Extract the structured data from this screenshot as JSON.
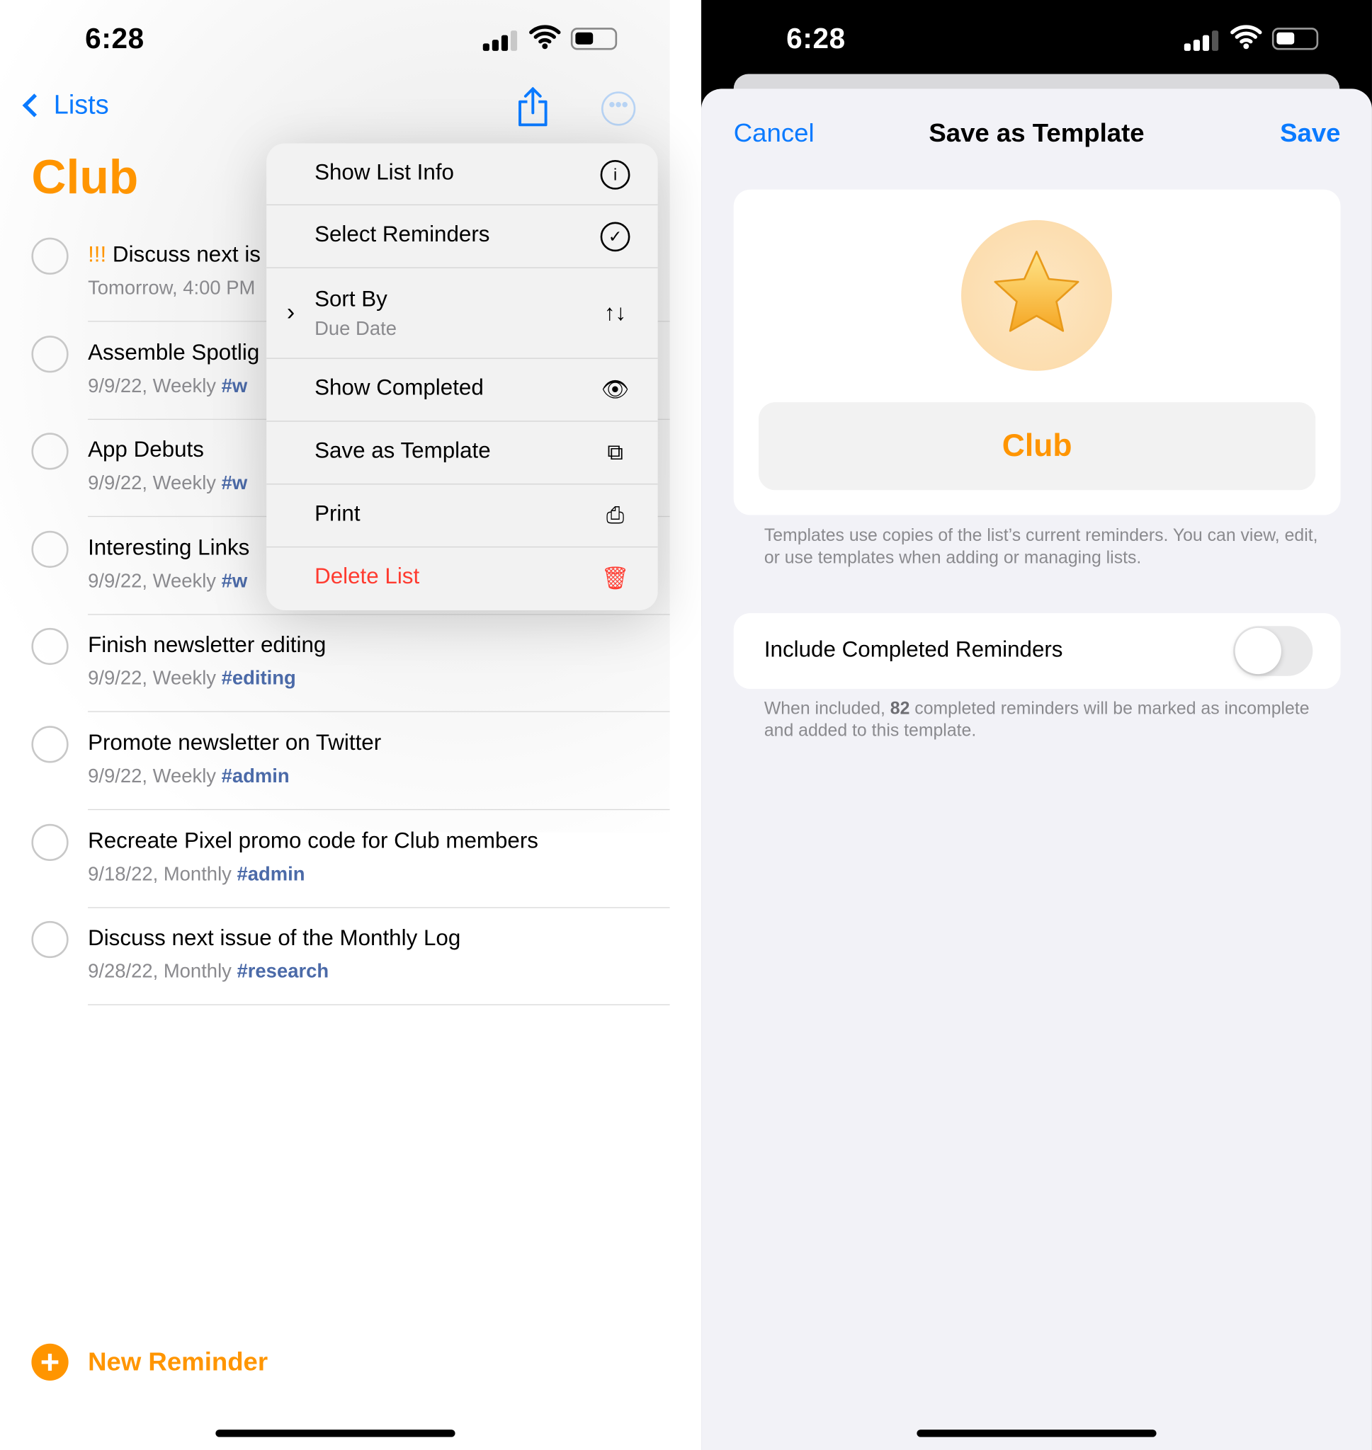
{
  "left": {
    "status": {
      "time": "6:28"
    },
    "nav": {
      "back_label": "Lists",
      "share_icon": "share-icon",
      "more_icon": "ellipsis-circle-icon"
    },
    "list_title": "Club",
    "accent": "#ff9500",
    "reminders": [
      {
        "priority": "!!!",
        "title": "Discuss next is",
        "date": "Tomorrow, 4:00 PM",
        "tag": ""
      },
      {
        "priority": "",
        "title": "Assemble Spotlig",
        "date": "9/9/22, Weekly",
        "tag": "#w"
      },
      {
        "priority": "",
        "title": "App Debuts",
        "date": "9/9/22, Weekly",
        "tag": "#w"
      },
      {
        "priority": "",
        "title": "Interesting Links",
        "date": "9/9/22, Weekly",
        "tag": "#w"
      },
      {
        "priority": "",
        "title": "Finish newsletter editing",
        "date": "9/9/22, Weekly",
        "tag": "#editing"
      },
      {
        "priority": "",
        "title": "Promote newsletter on Twitter",
        "date": "9/9/22, Weekly",
        "tag": "#admin"
      },
      {
        "priority": "",
        "title": "Recreate Pixel promo code for Club members",
        "date": "9/18/22, Monthly",
        "tag": "#admin"
      },
      {
        "priority": "",
        "title": "Discuss next issue of the Monthly Log",
        "date": "9/28/22, Monthly",
        "tag": "#research"
      }
    ],
    "menu": [
      {
        "label": "Show List Info",
        "icon": "info-circle-icon",
        "glyph": "ⓘ"
      },
      {
        "label": "Select Reminders",
        "icon": "checkmark-circle-icon",
        "glyph": "✓"
      },
      {
        "label": "Sort By",
        "sub": "Due Date",
        "icon": "sort-arrows-icon",
        "glyph": "↑↓"
      },
      {
        "label": "Show Completed",
        "icon": "eye-icon",
        "glyph": "👁"
      },
      {
        "label": "Save as Template",
        "icon": "plus-square-on-square-icon",
        "glyph": "⧉"
      },
      {
        "label": "Print",
        "icon": "printer-icon",
        "glyph": "⎙"
      },
      {
        "label": "Delete List",
        "icon": "trash-icon",
        "glyph": "🗑",
        "destructive": true
      }
    ],
    "new_reminder": "New Reminder"
  },
  "right": {
    "status": {
      "time": "6:28"
    },
    "cancel": "Cancel",
    "title": "Save as Template",
    "save": "Save",
    "list_icon": "star-icon",
    "name_value": "Club",
    "footer1": "Templates use copies of the list’s current reminders. You can view, edit, or use templates when adding or managing lists.",
    "toggle_label": "Include Completed Reminders",
    "toggle_on": false,
    "footer2_pre": "When included, ",
    "footer2_count": "82",
    "footer2_post": " completed reminders will be marked as incomplete and added to this template."
  }
}
